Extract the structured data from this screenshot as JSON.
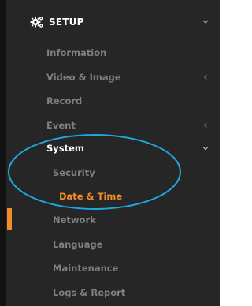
{
  "menu": {
    "header": {
      "label": "SETUP",
      "icon": "gears-icon",
      "expanded": true
    },
    "items": [
      {
        "label": "Information"
      },
      {
        "label": "Video & Image"
      },
      {
        "label": "Record"
      },
      {
        "label": "Event"
      },
      {
        "label": "System"
      }
    ],
    "system_children": [
      {
        "label": "Security"
      },
      {
        "label": "Date & Time"
      },
      {
        "label": "Network"
      },
      {
        "label": "Language"
      },
      {
        "label": "Maintenance"
      },
      {
        "label": "Logs & Report"
      }
    ]
  },
  "colors": {
    "background": "#262626",
    "text_muted": "#7f7f7f",
    "text_active": "#ffffff",
    "accent": "#f08c2a",
    "annotation": "#1ea7e1"
  }
}
